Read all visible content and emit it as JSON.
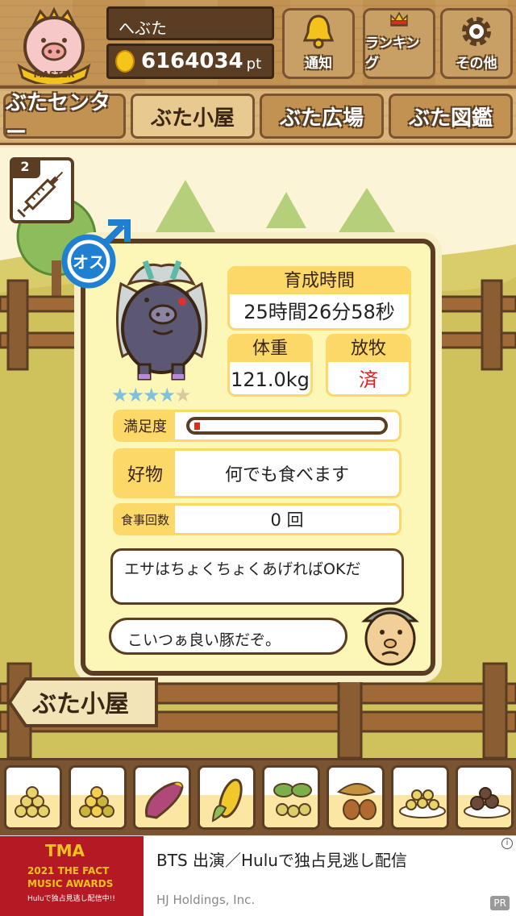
{
  "header": {
    "badge_text": "MASTER",
    "player_name": "へぶた",
    "points_value": "6164034",
    "points_unit": "pt",
    "buttons": [
      {
        "label": "通知",
        "icon": "bell-icon"
      },
      {
        "label": "ランキング",
        "icon": "crown-icon"
      },
      {
        "label": "その他",
        "icon": "gear-icon"
      }
    ]
  },
  "tabs": [
    {
      "label": "ぶたセンター",
      "active": false
    },
    {
      "label": "ぶた小屋",
      "active": true
    },
    {
      "label": "ぶた広場",
      "active": false
    },
    {
      "label": "ぶた図鑑",
      "active": false
    }
  ],
  "item": {
    "count": "2",
    "icon": "syringe-icon"
  },
  "pig": {
    "gender_label": "オス",
    "stars_filled": 4,
    "stars_total": 5,
    "stars_on_text": "★★★★",
    "stars_off_text": "★",
    "raise_time_label": "育成時間",
    "raise_time_value": "25時間26分58秒",
    "weight_label": "体重",
    "weight_value": "121.0kg",
    "graze_label": "放牧",
    "graze_value": "済",
    "satisfaction_label": "満足度",
    "satisfaction_fraction": 0.03,
    "favorite_label": "好物",
    "favorite_value": "何でも食べます",
    "meal_count_label": "食事回数",
    "meal_count_value": "0 回"
  },
  "dialogue": {
    "line1": "エサはちょくちょくあげればOKだ",
    "line2": "こいつぁ良い豚だぞ。"
  },
  "sign_text": "ぶた小屋",
  "foods": [
    "beans-icon",
    "mixed-beans-icon",
    "sweet-potato-icon",
    "corn-icon",
    "vegetable-icon",
    "acorn-icon",
    "grain-plate-icon",
    "meatball-plate-icon"
  ],
  "ad": {
    "image_title": "TMA",
    "image_line1": "2021 THE FACT",
    "image_line2": "MUSIC AWARDS",
    "image_line3": "Huluで独占見逃し配信中!!",
    "title": "BTS 出演／Huluで独占見逃し配信",
    "sponsor": "HJ Holdings, Inc.",
    "pr": "PR",
    "info": "i"
  },
  "colors": {
    "wood_dark": "#5a3d22",
    "wood": "#c29253",
    "card_bg": "#fcf6b7",
    "label_yellow": "#fbd867",
    "graze_red": "#e02020",
    "gender_blue": "#1f7fd0"
  }
}
